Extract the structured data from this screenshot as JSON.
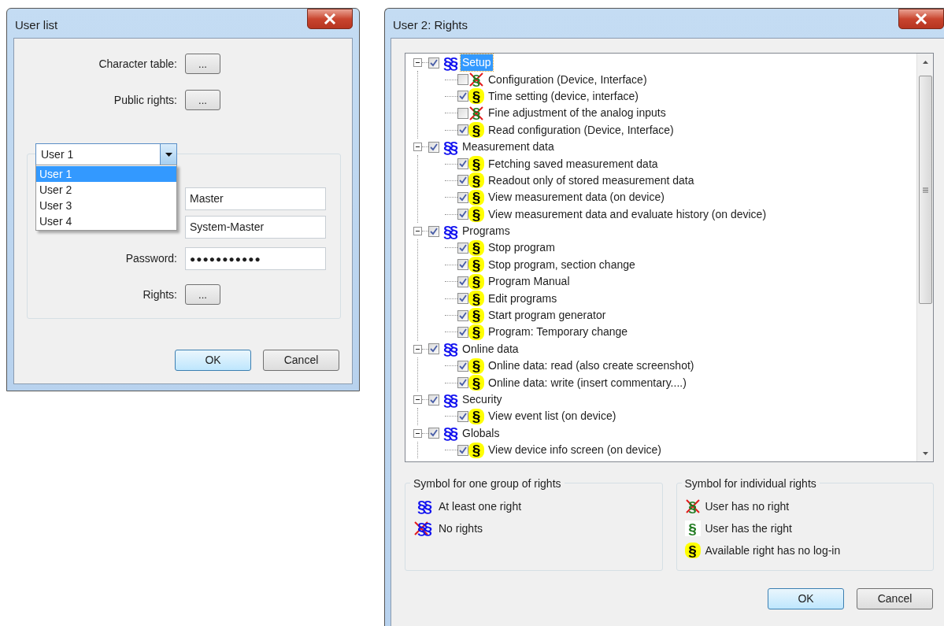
{
  "user_list": {
    "title": "User list",
    "character_table": {
      "label": "Character table:",
      "button": "..."
    },
    "public_rights": {
      "label": "Public rights:",
      "button": "..."
    },
    "user_select": {
      "value": "User 1",
      "options": [
        {
          "label": "User 1",
          "selected": true
        },
        {
          "label": "User 2",
          "selected": false
        },
        {
          "label": "User 3",
          "selected": false
        },
        {
          "label": "User 4",
          "selected": false
        }
      ]
    },
    "name_field": {
      "value": "Master"
    },
    "description_field": {
      "value": "System-Master"
    },
    "password": {
      "label": "Password:",
      "value": "●●●●●●●●●●●"
    },
    "rights": {
      "label": "Rights:",
      "button": "..."
    },
    "buttons": [
      {
        "label": "OK",
        "default": true
      },
      {
        "label": "Cancel",
        "default": false
      }
    ]
  },
  "rights_dialog": {
    "title": "User 2: Rights",
    "tree": [
      {
        "label": "Setup",
        "checked": true,
        "selected": true,
        "expanded": true,
        "symbol": "§§",
        "kind": "group_some",
        "children": [
          {
            "label": "Configuration (Device, Interface)",
            "checked": false,
            "symbol": "§",
            "kind": "right_none"
          },
          {
            "label": "Time setting (device, interface)",
            "checked": true,
            "symbol": "§",
            "kind": "right_nologin"
          },
          {
            "label": "Fine adjustment of the analog inputs",
            "checked": false,
            "symbol": "§",
            "kind": "right_none"
          },
          {
            "label": "Read configuration (Device, Interface)",
            "checked": true,
            "symbol": "§",
            "kind": "right_nologin"
          }
        ]
      },
      {
        "label": "Measurement data",
        "checked": true,
        "selected": false,
        "expanded": true,
        "symbol": "§§",
        "kind": "group_some",
        "children": [
          {
            "label": "Fetching saved measurement data",
            "checked": true,
            "symbol": "§",
            "kind": "right_nologin"
          },
          {
            "label": "Readout only of stored measurement data",
            "checked": true,
            "symbol": "§",
            "kind": "right_nologin"
          },
          {
            "label": "View measurement data (on device)",
            "checked": true,
            "symbol": "§",
            "kind": "right_nologin"
          },
          {
            "label": "View measurement data and evaluate history (on device)",
            "checked": true,
            "symbol": "§",
            "kind": "right_nologin"
          }
        ]
      },
      {
        "label": "Programs",
        "checked": true,
        "selected": false,
        "expanded": true,
        "symbol": "§§",
        "kind": "group_some",
        "children": [
          {
            "label": "Stop program",
            "checked": true,
            "symbol": "§",
            "kind": "right_nologin"
          },
          {
            "label": "Stop program, section change",
            "checked": true,
            "symbol": "§",
            "kind": "right_nologin"
          },
          {
            "label": "Program Manual",
            "checked": true,
            "symbol": "§",
            "kind": "right_nologin"
          },
          {
            "label": "Edit programs",
            "checked": true,
            "symbol": "§",
            "kind": "right_nologin"
          },
          {
            "label": "Start program generator",
            "checked": true,
            "symbol": "§",
            "kind": "right_nologin"
          },
          {
            "label": "Program: Temporary change",
            "checked": true,
            "symbol": "§",
            "kind": "right_nologin"
          }
        ]
      },
      {
        "label": "Online data",
        "checked": true,
        "selected": false,
        "expanded": true,
        "symbol": "§§",
        "kind": "group_some",
        "children": [
          {
            "label": "Online data: read (also create screenshot)",
            "checked": true,
            "symbol": "§",
            "kind": "right_nologin"
          },
          {
            "label": "Online data: write (insert commentary....)",
            "checked": true,
            "symbol": "§",
            "kind": "right_nologin"
          }
        ]
      },
      {
        "label": "Security",
        "checked": true,
        "selected": false,
        "expanded": true,
        "symbol": "§§",
        "kind": "group_some",
        "children": [
          {
            "label": "View event list (on device)",
            "checked": true,
            "symbol": "§",
            "kind": "right_nologin"
          }
        ]
      },
      {
        "label": "Globals",
        "checked": true,
        "selected": false,
        "expanded": true,
        "symbol": "§§",
        "kind": "group_some",
        "children": [
          {
            "label": "View device info screen (on device)",
            "checked": true,
            "symbol": "§",
            "kind": "right_nologin"
          }
        ]
      }
    ],
    "legend_groups": {
      "title": "Symbol for one group of rights",
      "items": [
        {
          "symbol": "§§",
          "kind": "group_some",
          "label": "At least one right"
        },
        {
          "symbol": "§§",
          "kind": "group_none",
          "label": "No rights"
        }
      ]
    },
    "legend_individual": {
      "title": "Symbol for individual rights",
      "items": [
        {
          "symbol": "§",
          "kind": "right_none",
          "label": "User has no right"
        },
        {
          "symbol": "§",
          "kind": "right_has",
          "label": "User has the right"
        },
        {
          "symbol": "§",
          "kind": "right_nologin",
          "label": "Available right has no log-in"
        }
      ]
    },
    "buttons": [
      {
        "label": "OK",
        "default": true
      },
      {
        "label": "Cancel",
        "default": false
      }
    ]
  }
}
